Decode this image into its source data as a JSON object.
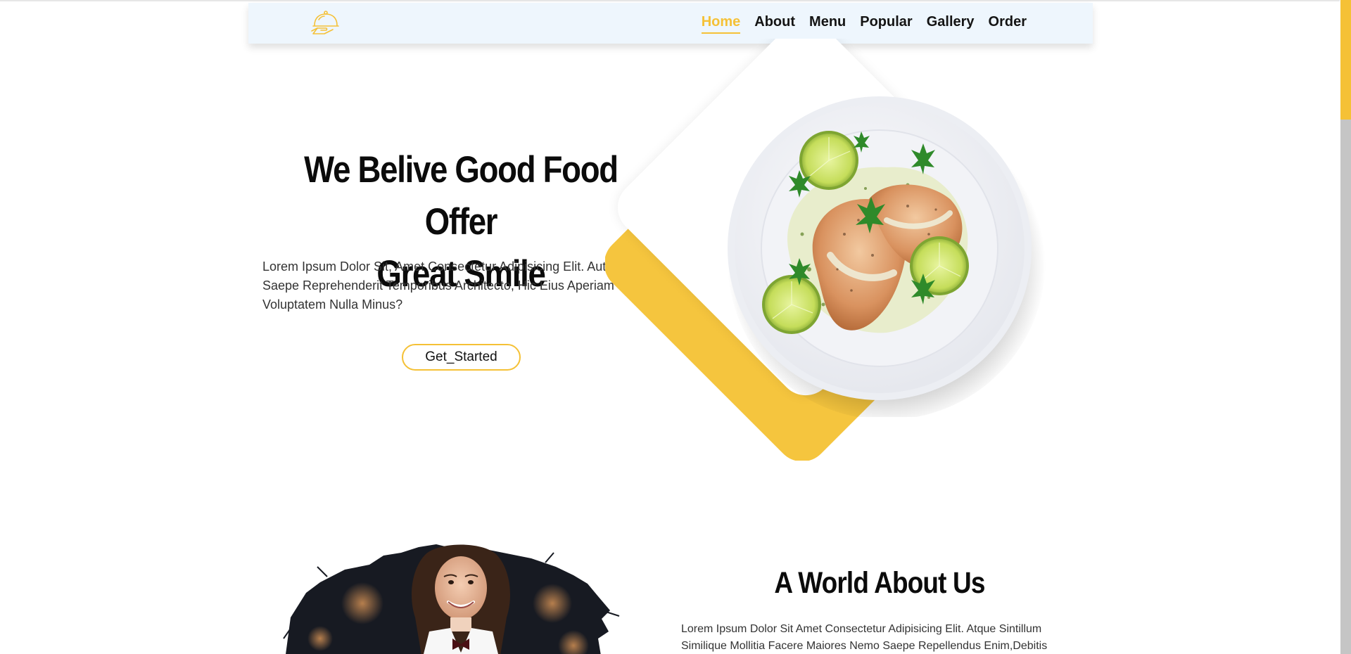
{
  "nav": {
    "logo_icon": "cloche-serving-icon",
    "links": [
      {
        "label": "Home",
        "active": true
      },
      {
        "label": "About",
        "active": false
      },
      {
        "label": "Menu",
        "active": false
      },
      {
        "label": "Popular",
        "active": false
      },
      {
        "label": "Gallery",
        "active": false
      },
      {
        "label": "Order",
        "active": false
      }
    ]
  },
  "hero": {
    "title_line1": "We Belive Good Food Offer",
    "title_line2": "Great Smile",
    "description": "Lorem Ipsum Dolor Sit, Amet Consectetur Adipisicing Elit. Aut Rerum Saepe Reprehenderit Temporibus Architecto, Hic Eius Aperiam Voluptatem Nulla Minus?",
    "button_label": "Get_Started",
    "image": "grilled-chicken-plate"
  },
  "about": {
    "title": "A World About Us",
    "description": "Lorem Ipsum Dolor Sit Amet Consectetur Adipisicing Elit. Atque Sintillum Similique Mollitia Facere Maiores Nemo Saepe Repellendus Enim,Debitis",
    "image": "waitress-portrait"
  },
  "colors": {
    "accent": "#f5c136",
    "nav_bg": "#eef6fd",
    "text": "#111111"
  }
}
